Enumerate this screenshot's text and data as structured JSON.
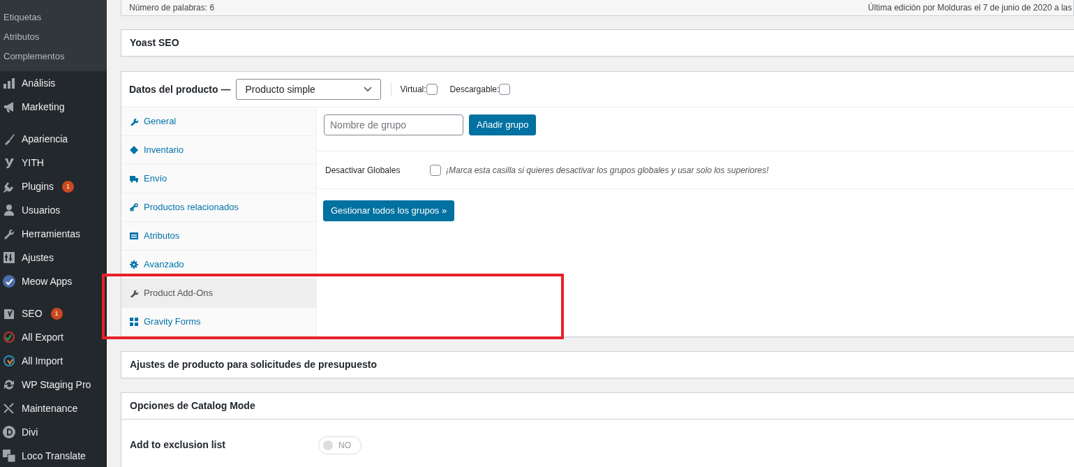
{
  "sidebar": {
    "submenu": [
      "Etiquetas",
      "Atributos",
      "Complementos"
    ],
    "menu_groups": [
      [
        {
          "label": "Análisis"
        },
        {
          "label": "Marketing"
        }
      ],
      [
        {
          "label": "Apariencia"
        },
        {
          "label": "YITH"
        },
        {
          "label": "Plugins",
          "badge": "1"
        },
        {
          "label": "Usuarios"
        },
        {
          "label": "Herramientas"
        },
        {
          "label": "Ajustes"
        },
        {
          "label": "Meow Apps"
        }
      ],
      [
        {
          "label": "SEO",
          "badge": "1"
        },
        {
          "label": "All Export"
        },
        {
          "label": "All Import"
        },
        {
          "label": "WP Staging Pro"
        },
        {
          "label": "Maintenance"
        },
        {
          "label": "Divi"
        },
        {
          "label": "Loco Translate"
        }
      ]
    ]
  },
  "status_row": {
    "word_count": "Número de palabras: 6",
    "last_edit": "Última edición por Molduras el 7 de junio de 2020 a las"
  },
  "yoast_panel": {
    "title": "Yoast SEO"
  },
  "product_data": {
    "title": "Datos del producto —",
    "type_select": "Producto simple",
    "options": [
      {
        "label": "Virtual:",
        "checked": false
      },
      {
        "label": "Descargable:",
        "checked": false
      }
    ],
    "tabs": [
      {
        "label": "General",
        "selected": false
      },
      {
        "label": "Inventario",
        "selected": false
      },
      {
        "label": "Envío",
        "selected": false
      },
      {
        "label": "Productos relacionados",
        "selected": false
      },
      {
        "label": "Atributos",
        "selected": false
      },
      {
        "label": "Avanzado",
        "selected": false
      },
      {
        "label": "Product Add-Ons",
        "selected": true
      },
      {
        "label": "Gravity Forms",
        "selected": false
      }
    ],
    "group_name": {
      "placeholder": "Nombre de grupo"
    },
    "add_group_button": "Añadir grupo",
    "disable_globals": {
      "label": "Desactivar Globales",
      "checked": false,
      "description": "¡Marca esta casilla si quieres desactivar los grupos globales y usar solo los superiores!"
    },
    "manage_button": "Gestionar todos los grupos »"
  },
  "quote_panel": {
    "title": "Ajustes de producto para solicitudes de presupuesto"
  },
  "catalog_panel": {
    "title": "Opciones de Catalog Mode",
    "rows": [
      {
        "label": "Add to exclusion list",
        "on": false,
        "toggle_text": "NO"
      }
    ]
  }
}
